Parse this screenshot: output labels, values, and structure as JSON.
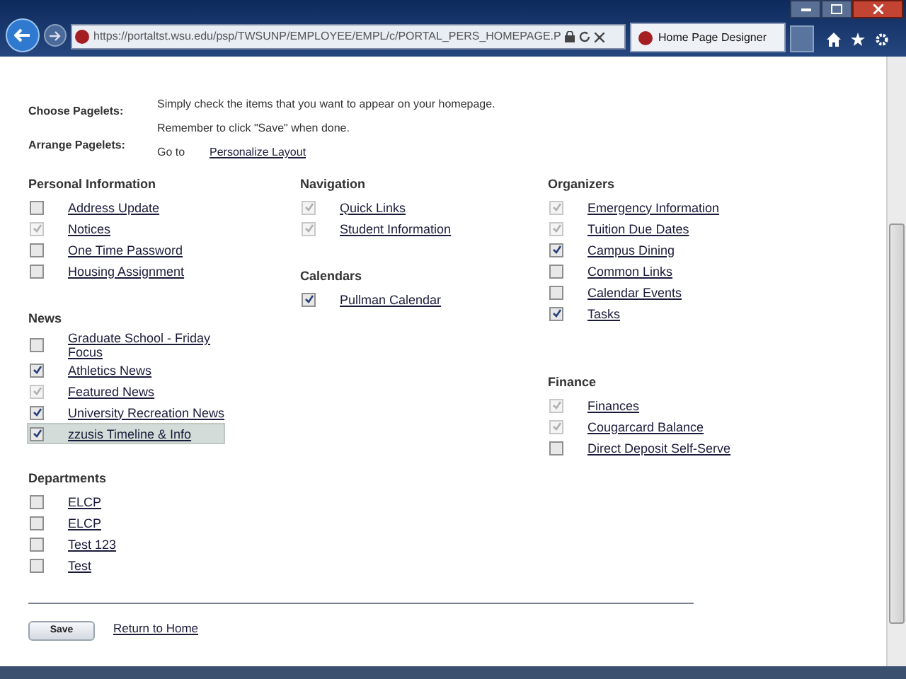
{
  "browser": {
    "url": "https://portaltst.wsu.edu/psp/TWSUNP/EMPLOYEE/EMPL/c/PORTAL_PERS_HOMEPAGE.P",
    "tab_title": "Home Page Designer"
  },
  "intro": {
    "choose_label": "Choose Pagelets:",
    "choose_text": [
      "Simply check the items that you want to appear on your homepage.",
      "Remember to click \"Save\" when done."
    ],
    "arrange_label": "Arrange Pagelets:",
    "arrange_prefix": "Go to",
    "arrange_link": "Personalize Layout"
  },
  "columns": [
    [
      {
        "title": "Personal Information",
        "items": [
          {
            "label": "Address Update",
            "checked": false,
            "disabled": false,
            "highlighted": false
          },
          {
            "label": "Notices",
            "checked": true,
            "disabled": true,
            "highlighted": false
          },
          {
            "label": "One Time Password",
            "checked": false,
            "disabled": false,
            "highlighted": false
          },
          {
            "label": "Housing Assignment",
            "checked": false,
            "disabled": false,
            "highlighted": false
          }
        ]
      },
      {
        "title": "News",
        "items": [
          {
            "label": "Graduate School - Friday Focus",
            "checked": false,
            "disabled": false,
            "highlighted": false
          },
          {
            "label": "Athletics News",
            "checked": true,
            "disabled": false,
            "highlighted": false
          },
          {
            "label": "Featured News",
            "checked": true,
            "disabled": true,
            "highlighted": false
          },
          {
            "label": "University Recreation News",
            "checked": true,
            "disabled": false,
            "highlighted": false
          },
          {
            "label": "zzusis Timeline & Info",
            "checked": true,
            "disabled": false,
            "highlighted": true
          }
        ]
      }
    ],
    [
      {
        "title": "Navigation",
        "items": [
          {
            "label": "Quick Links",
            "checked": true,
            "disabled": true,
            "highlighted": false
          },
          {
            "label": "Student Information",
            "checked": true,
            "disabled": true,
            "highlighted": false
          }
        ]
      },
      {
        "title": "Calendars",
        "items": [
          {
            "label": "Pullman Calendar",
            "checked": true,
            "disabled": false,
            "highlighted": false
          }
        ]
      }
    ],
    [
      {
        "title": "Organizers",
        "items": [
          {
            "label": "Emergency Information",
            "checked": true,
            "disabled": true,
            "highlighted": false
          },
          {
            "label": "Tuition Due Dates",
            "checked": true,
            "disabled": true,
            "highlighted": false
          },
          {
            "label": "Campus Dining",
            "checked": true,
            "disabled": false,
            "highlighted": false
          },
          {
            "label": "Common Links",
            "checked": false,
            "disabled": false,
            "highlighted": false
          },
          {
            "label": "Calendar Events",
            "checked": false,
            "disabled": false,
            "highlighted": false
          },
          {
            "label": "Tasks",
            "checked": true,
            "disabled": false,
            "highlighted": false
          }
        ]
      },
      {
        "title": "Finance",
        "items": [
          {
            "label": "Finances",
            "checked": true,
            "disabled": true,
            "highlighted": false
          },
          {
            "label": "Cougarcard Balance",
            "checked": true,
            "disabled": true,
            "highlighted": false
          },
          {
            "label": "Direct Deposit Self-Serve",
            "checked": false,
            "disabled": false,
            "highlighted": false
          }
        ]
      }
    ]
  ],
  "departments": {
    "title": "Departments",
    "items": [
      {
        "label": "ELCP",
        "checked": false,
        "disabled": false,
        "highlighted": false
      },
      {
        "label": "ELCP",
        "checked": false,
        "disabled": false,
        "highlighted": false
      },
      {
        "label": "Test 123",
        "checked": false,
        "disabled": false,
        "highlighted": false
      },
      {
        "label": "Test",
        "checked": false,
        "disabled": false,
        "highlighted": false
      }
    ]
  },
  "save_button": "Save",
  "return_link": "Return to Home"
}
